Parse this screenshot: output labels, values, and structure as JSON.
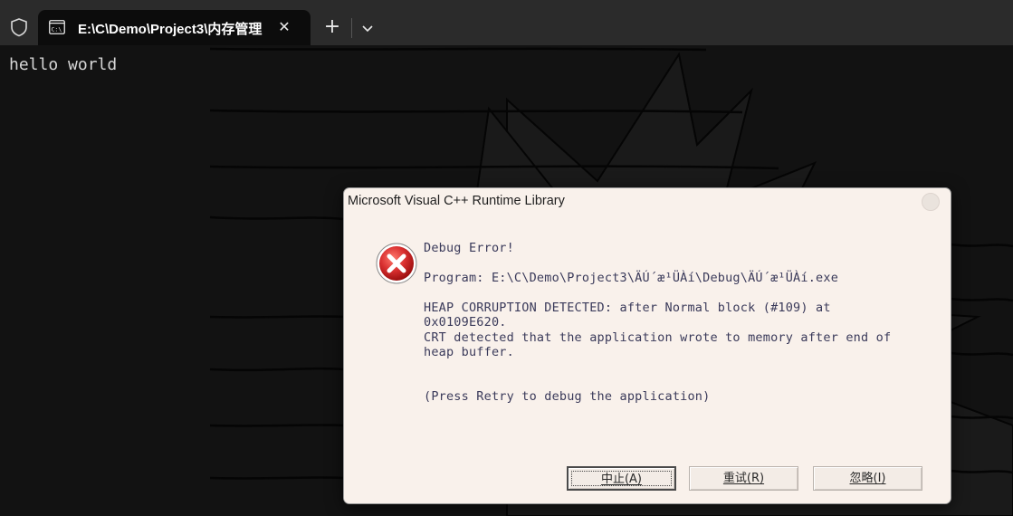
{
  "tab": {
    "title": "E:\\C\\Demo\\Project3\\内存管理",
    "close_glyph": "✕"
  },
  "new_tab_glyph": "+",
  "terminal": {
    "output": "hello world"
  },
  "dialog": {
    "title": "Microsoft Visual C++ Runtime Library",
    "lines": [
      "Debug Error!",
      "Program: E:\\C\\Demo\\Project3\\ÄÚ´æ¹ÜÀí\\Debug\\ÄÚ´æ¹ÜÀí.exe",
      "HEAP CORRUPTION DETECTED: after Normal block (#109) at",
      "0x0109E620.",
      "CRT detected that the application wrote to memory after end of",
      "heap buffer.",
      "(Press Retry to debug the application)"
    ],
    "buttons": {
      "abort": "中止(A)",
      "retry": "重试(R)",
      "ignore": "忽略(I)"
    }
  },
  "icons": {
    "shield": "shield-icon",
    "terminal": "terminal-icon",
    "close": "close-icon",
    "add": "plus-icon",
    "dropdown": "chevron-down-icon",
    "error": "error-icon"
  },
  "colors": {
    "titlebar_bg": "#2b2b2b",
    "terminal_bg": "#121212",
    "dialog_bg": "#f9f1eb",
    "error_red": "#d93030"
  }
}
